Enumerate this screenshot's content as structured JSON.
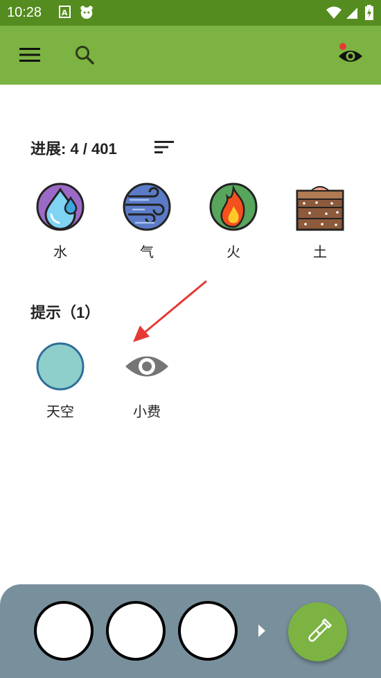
{
  "status_bar": {
    "time": "10:28"
  },
  "appbar": {
    "menu_icon": "menu-icon",
    "search_icon": "search-icon",
    "visibility_icon": "eye-icon",
    "notification_dot_color": "#e53935"
  },
  "progress": {
    "label": "进展: 4 / 401"
  },
  "elements": [
    {
      "name": "水",
      "icon": "water-drop-icon"
    },
    {
      "name": "气",
      "icon": "air-icon"
    },
    {
      "name": "火",
      "icon": "fire-icon"
    },
    {
      "name": "土",
      "icon": "earth-icon"
    }
  ],
  "hints": {
    "title": "提示（1）",
    "items": [
      {
        "name": "天空",
        "icon": "sky-circle-icon"
      },
      {
        "name": "小费",
        "icon": "eye-icon"
      }
    ]
  },
  "bottom_bar": {
    "slot_count": 3,
    "play_icon": "play-arrow-icon",
    "fab_icon": "test-tube-icon"
  },
  "colors": {
    "primary": "#7cb342",
    "status_bar": "#548c1f",
    "panel": "#78909c",
    "arrow": "#e53935"
  }
}
